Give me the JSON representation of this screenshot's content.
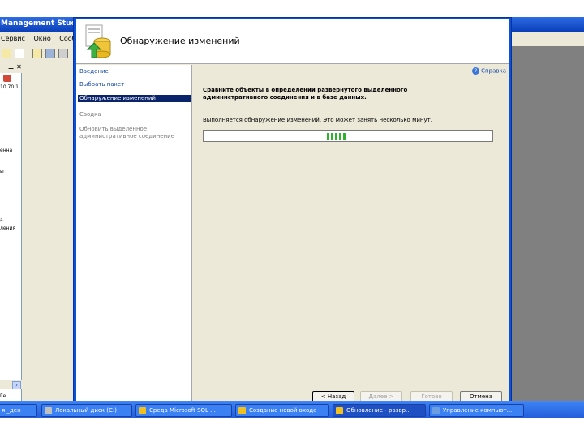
{
  "ssms": {
    "title": "Management Studio",
    "menu": [
      "Сервис",
      "Окно",
      "Сооб"
    ],
    "object_panel": {
      "pin_close": "⊥ ✕",
      "text_fragments": [
        "10.70.1",
        "енна",
        "ы",
        "а",
        "ления"
      ],
      "status": "Ге ..."
    }
  },
  "dialog": {
    "title": "Обнаружение изменений",
    "help_label": "Справка",
    "nav": [
      {
        "label": "Введение"
      },
      {
        "label": "Выбрать пакет"
      },
      {
        "label": "Обнаружение изменений"
      },
      {
        "label": "Сводка"
      },
      {
        "label": "Обновить выделенное"
      },
      {
        "label": "административное соединение"
      }
    ],
    "description": "Сравните объекты в определении развернутого выделенного административного соединения и в базе данных.",
    "status_text": "Выполняется обнаружение изменений. Это может занять несколько минут.",
    "progress": {
      "segments": 5,
      "state": "indeterminate"
    },
    "buttons": {
      "back": "< Назад",
      "next": "Далее >",
      "finish": "Готово",
      "cancel": "Отмена"
    }
  },
  "taskbar": {
    "items": [
      {
        "label": "я _ден",
        "color": "#2a5fd0"
      },
      {
        "label": "Локальный диск (C:)",
        "color": "#c0c0c0"
      },
      {
        "label": "Среда Microsoft SQL ...",
        "color": "#f0c020"
      },
      {
        "label": "Создание новой входа",
        "color": "#f0c020"
      },
      {
        "label": "Обновление - развр...",
        "color": "#f0c020"
      },
      {
        "label": "Управление компьют...",
        "color": "#6a9ee0"
      }
    ]
  }
}
